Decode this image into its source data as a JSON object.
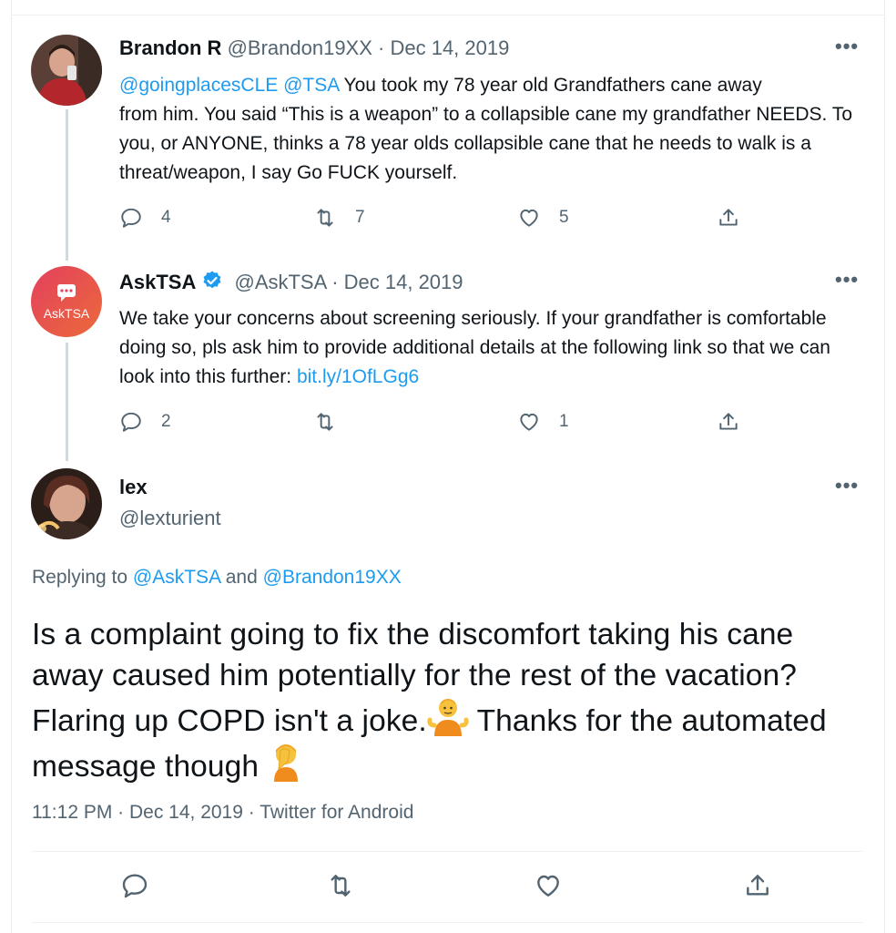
{
  "tweets": [
    {
      "name": "Brandon R",
      "handle": "@Brandon19XX",
      "date": "· Dec 14, 2019",
      "mentions": "@goingplacesCLE @TSA",
      "text_line1": " You took my 78 year old Grandfathers cane away",
      "text_rest": "from him. You said “This is a weapon” to a collapsible cane my grandfather NEEDS. To you, or ANYONE, thinks a 78 year olds collapsible cane that he needs to walk is a threat/weapon, I say Go FUCK yourself.",
      "replies": "4",
      "retweets": "7",
      "likes": "5",
      "more": "•••"
    },
    {
      "name": "AskTSA",
      "handle": "@AskTSA",
      "date": "· Dec 14, 2019",
      "avatar_label": "AskTSA",
      "text": "We take your concerns about screening seriously. If your grandfather is comfortable doing so, pls ask him to provide additional details at the following link so that we can look into this further: ",
      "link": "bit.ly/1OfLGg6",
      "replies": "2",
      "retweets": "",
      "likes": "1",
      "more": "•••"
    }
  ],
  "main_tweet": {
    "name": "lex",
    "handle": "@lexturient",
    "more": "•••",
    "replying_prefix": "Replying to ",
    "replying_to_1": "@AskTSA",
    "replying_and": " and ",
    "replying_to_2": "@Brandon19XX",
    "text_part1": "Is a complaint going to fix the discomfort taking his cane away caused him potentially for the rest of the vacation? Flaring up COPD isn't a joke.",
    "emoji1": "person-shrugging-emoji",
    "text_part2": " Thanks for the automated message though ",
    "emoji2": "person-facepalming-emoji",
    "meta": "11:12 PM · Dec 14, 2019 · Twitter for Android"
  },
  "colors": {
    "accent": "#1d9bf0",
    "muted": "#536471",
    "text": "#0f1419",
    "tsa_avatar": "#e8484f",
    "verified": "#1d9bf0"
  },
  "icons": [
    "reply-icon",
    "retweet-icon",
    "like-icon",
    "share-icon",
    "verified-badge-icon",
    "more-icon"
  ]
}
